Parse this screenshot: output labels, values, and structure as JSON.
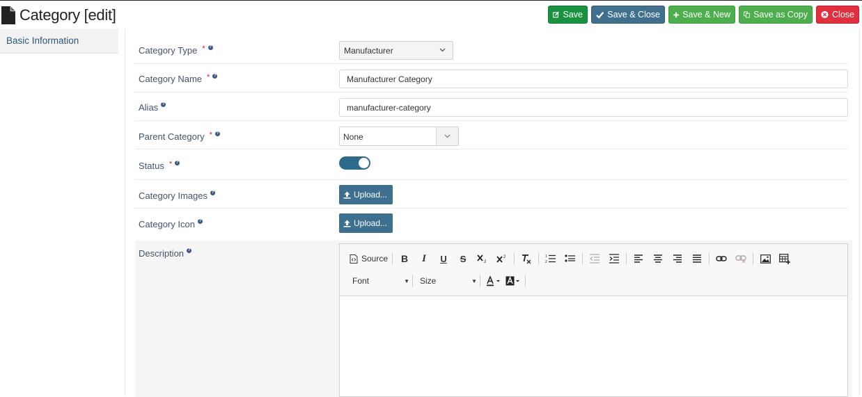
{
  "header": {
    "title": "Category [edit]",
    "buttons": {
      "save": "Save",
      "save_close": "Save & Close",
      "save_new": "Save & New",
      "save_copy": "Save as Copy",
      "close": "Close"
    }
  },
  "sidebar": {
    "items": [
      {
        "label": "Basic Information"
      }
    ]
  },
  "form": {
    "category_type": {
      "label": "Category Type",
      "required": "*",
      "value": "Manufacturer"
    },
    "category_name": {
      "label": "Category Name",
      "required": "*",
      "value": "Manufacturer Category"
    },
    "alias": {
      "label": "Alias",
      "value": "manufacturer-category"
    },
    "parent_category": {
      "label": "Parent Category",
      "required": "*",
      "value": "None"
    },
    "status": {
      "label": "Status",
      "required": "*",
      "enabled": true
    },
    "category_images": {
      "label": "Category Images",
      "button": "Upload..."
    },
    "category_icon": {
      "label": "Category Icon",
      "button": "Upload..."
    },
    "description": {
      "label": "Description",
      "toolbar": {
        "source": "Source",
        "font": "Font",
        "size": "Size",
        "bold": "B",
        "italic": "I",
        "underline": "U",
        "strike": "S"
      },
      "content": ""
    }
  },
  "colors": {
    "save": "#19923f",
    "save_close": "#41708f",
    "save_new": "#4cae4c",
    "save_copy": "#4cae4c",
    "close": "#e0303d",
    "primary": "#3d6f8e",
    "required": "#d0142b"
  }
}
